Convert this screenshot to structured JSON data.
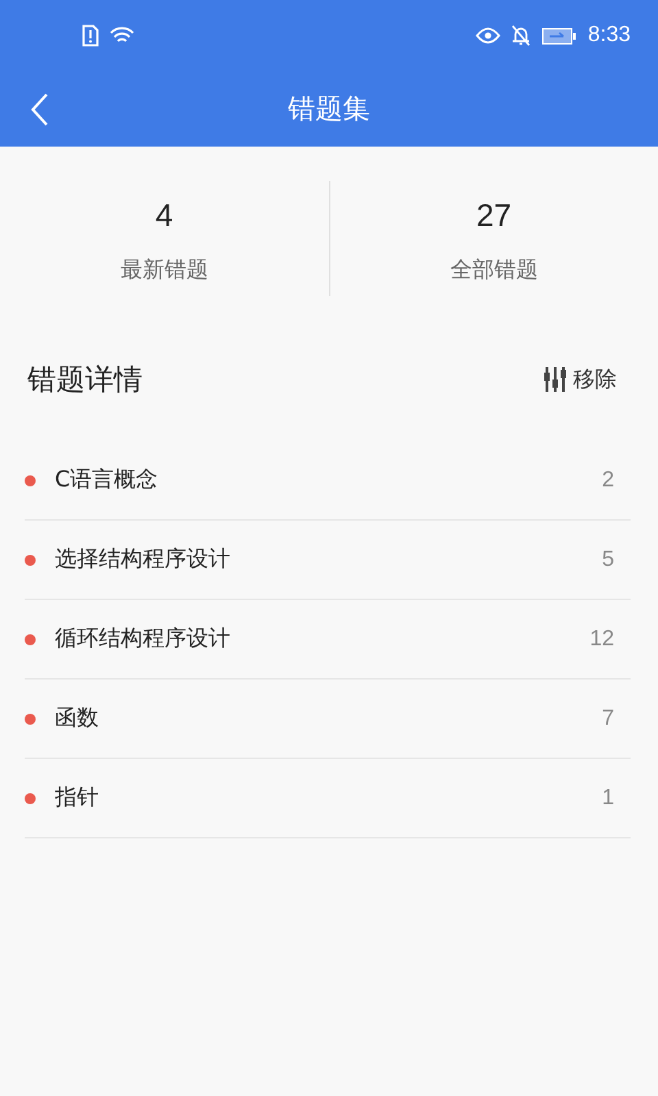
{
  "status_bar": {
    "time": "8:33"
  },
  "header": {
    "title": "错题集"
  },
  "stats": [
    {
      "value": "4",
      "label": "最新错题"
    },
    {
      "value": "27",
      "label": "全部错题"
    }
  ],
  "section": {
    "title": "错题详情",
    "action": "移除"
  },
  "items": [
    {
      "name": "C语言概念",
      "count": "2"
    },
    {
      "name": "选择结构程序设计",
      "count": "5"
    },
    {
      "name": "循环结构程序设计",
      "count": "12"
    },
    {
      "name": "函数",
      "count": "7"
    },
    {
      "name": "指针",
      "count": "1"
    }
  ]
}
